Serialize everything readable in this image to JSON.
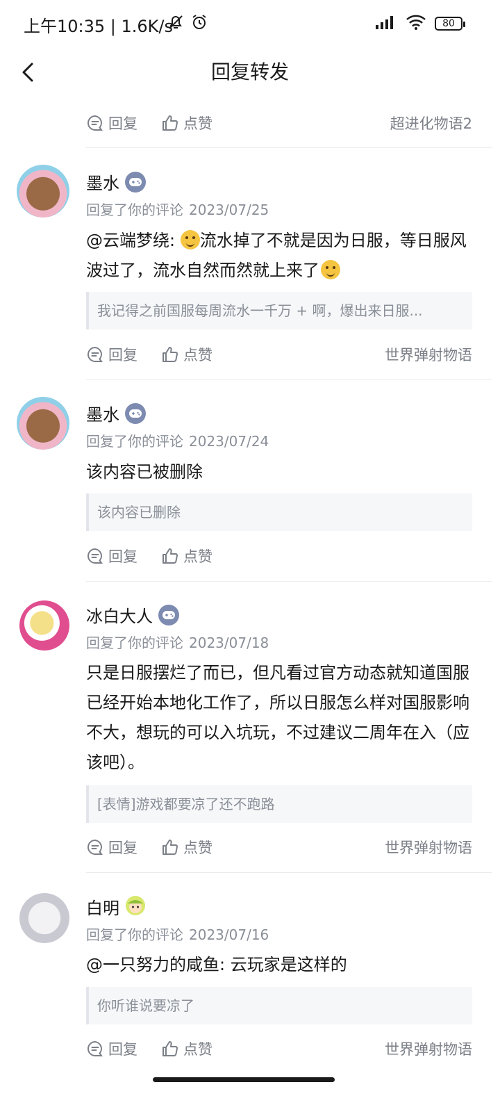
{
  "status_bar": {
    "time": "上午10:35 | 1.6K/s",
    "battery": "80"
  },
  "header": {
    "title": "回复转发"
  },
  "action_labels": {
    "reply": "回复",
    "like": "点赞"
  },
  "top_actions": {
    "source": "超进化物语2"
  },
  "comments": [
    {
      "name": "墨水",
      "meta_label": "回复了你的评论",
      "date": "2023/07/25",
      "content_prefix": "@云端梦绕: ",
      "content_rest": "流水掉了不就是因为日服，等日服风波过了，流水自然而然就上来了",
      "quote": "我记得之前国服每周流水一千万 + 啊，爆出来日服...",
      "source": "世界弹射物语"
    },
    {
      "name": "墨水",
      "meta_label": "回复了你的评论",
      "date": "2023/07/24",
      "content": "该内容已被删除",
      "quote": "该内容已删除",
      "source": ""
    },
    {
      "name": "冰白大人",
      "meta_label": "回复了你的评论",
      "date": "2023/07/18",
      "content": "只是日服摆烂了而已，但凡看过官方动态就知道国服已经开始本地化工作了，所以日服怎么样对国服影响不大，想玩的可以入坑玩，不过建议二周年在入（应该吧）。",
      "quote": "[表情]游戏都要凉了还不跑路",
      "source": "世界弹射物语"
    },
    {
      "name": "白明",
      "meta_label": "回复了你的评论",
      "date": "2023/07/16",
      "content": "@一只努力的咸鱼: 云玩家是这样的",
      "quote": "你听谁说要凉了",
      "source": "世界弹射物语"
    }
  ],
  "colors": {
    "muted": "#7b7f87",
    "badge": "#7d8bb1",
    "quote_bg": "#f6f7f9"
  }
}
